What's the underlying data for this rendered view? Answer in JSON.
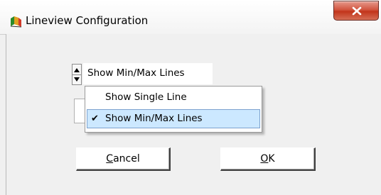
{
  "window": {
    "title": "Lineview Configuration",
    "close_icon": "close-x-icon",
    "app_icon": "lineview-app-icon"
  },
  "display_mode": {
    "selected": "Show Min/Max Lines",
    "options": [
      {
        "label": "Show Single Line",
        "checked": false
      },
      {
        "label": "Show Min/Max Lines",
        "checked": true
      }
    ],
    "check_glyph": "✔"
  },
  "buttons": {
    "cancel": {
      "mnemonic": "C",
      "rest": "ancel"
    },
    "ok": {
      "mnemonic": "O",
      "rest": "K"
    }
  },
  "colors": {
    "highlight": "#cce8ff",
    "close_button": "#c2351b"
  }
}
